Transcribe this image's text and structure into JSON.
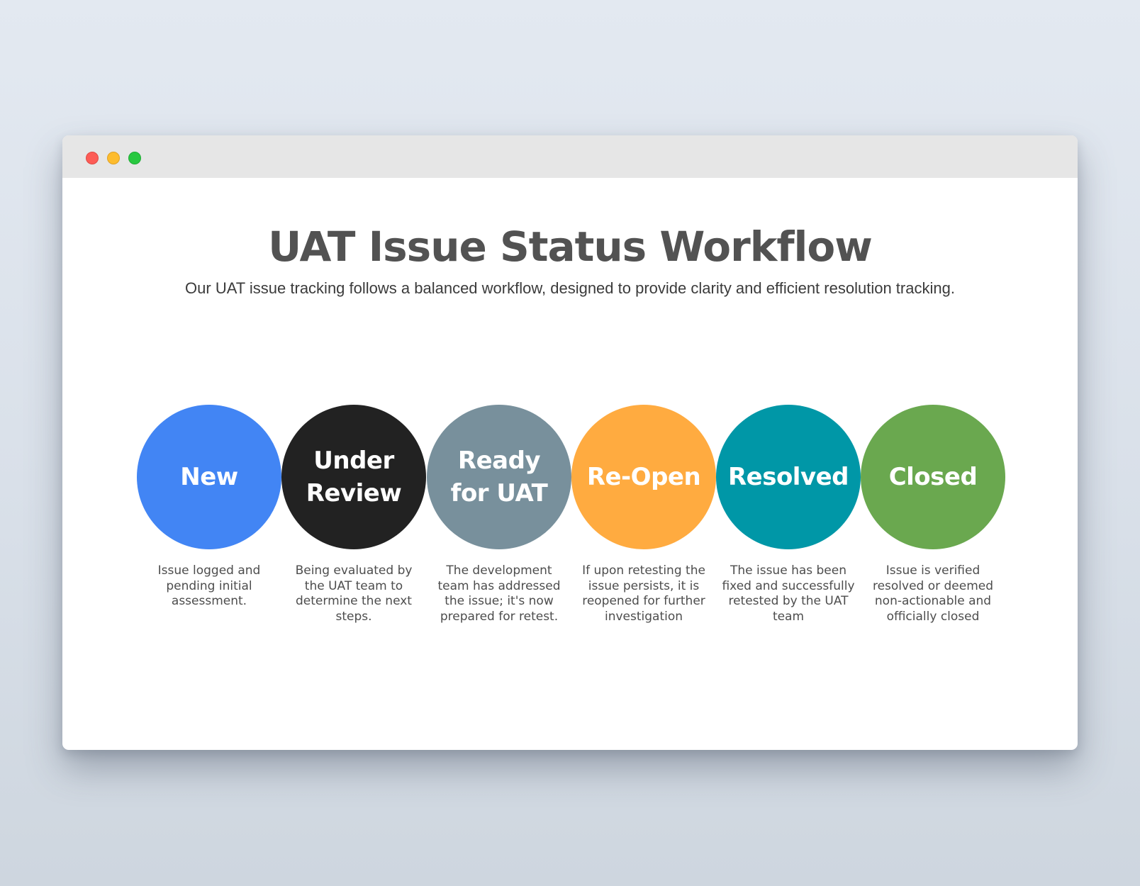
{
  "window": {
    "controls": [
      "close",
      "minimize",
      "maximize"
    ]
  },
  "header": {
    "title": "UAT Issue Status Workflow",
    "subtitle": "Our UAT issue tracking follows a balanced workflow, designed to provide clarity and efficient resolution tracking."
  },
  "stages": [
    {
      "label": "New",
      "color": "#4285f4",
      "description": "Issue logged and pending initial assessment."
    },
    {
      "label": "Under\nReview",
      "color": "#222222",
      "description": "Being evaluated by the UAT team to determine the next steps."
    },
    {
      "label": "Ready\nfor UAT",
      "color": "#78909c",
      "description": "The development team has addressed the issue; it's now prepared for retest."
    },
    {
      "label": "Re-Open",
      "color": "#ffab40",
      "description": "If upon retesting the issue persists, it is reopened for further investigation"
    },
    {
      "label": "Resolved",
      "color": "#0097a7",
      "description": "The issue has been fixed and successfully retested by the UAT team"
    },
    {
      "label": "Closed",
      "color": "#6aa84f",
      "description": "Issue is verified resolved or deemed non-actionable and officially closed"
    }
  ]
}
